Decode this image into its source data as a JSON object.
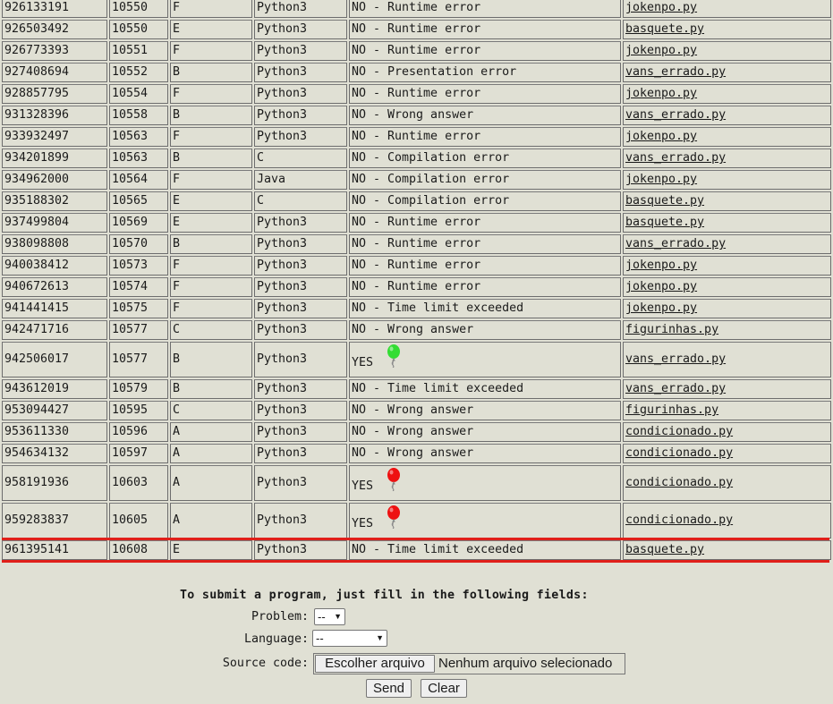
{
  "runs": [
    {
      "id": "926133191",
      "problem": "10550",
      "letter": "F",
      "lang": "Python3",
      "answer": "NO - Runtime error",
      "file": "jokenpo.py"
    },
    {
      "id": "926503492",
      "problem": "10550",
      "letter": "E",
      "lang": "Python3",
      "answer": "NO - Runtime error",
      "file": "basquete.py"
    },
    {
      "id": "926773393",
      "problem": "10551",
      "letter": "F",
      "lang": "Python3",
      "answer": "NO - Runtime error",
      "file": "jokenpo.py"
    },
    {
      "id": "927408694",
      "problem": "10552",
      "letter": "B",
      "lang": "Python3",
      "answer": "NO - Presentation error",
      "file": "vans_errado.py"
    },
    {
      "id": "928857795",
      "problem": "10554",
      "letter": "F",
      "lang": "Python3",
      "answer": "NO - Runtime error",
      "file": "jokenpo.py"
    },
    {
      "id": "931328396",
      "problem": "10558",
      "letter": "B",
      "lang": "Python3",
      "answer": "NO - Wrong answer",
      "file": "vans_errado.py"
    },
    {
      "id": "933932497",
      "problem": "10563",
      "letter": "F",
      "lang": "Python3",
      "answer": "NO - Runtime error",
      "file": "jokenpo.py"
    },
    {
      "id": "934201899",
      "problem": "10563",
      "letter": "B",
      "lang": "C",
      "answer": "NO - Compilation error",
      "file": "vans_errado.py"
    },
    {
      "id": "934962000",
      "problem": "10564",
      "letter": "F",
      "lang": "Java",
      "answer": "NO - Compilation error",
      "file": "jokenpo.py"
    },
    {
      "id": "935188302",
      "problem": "10565",
      "letter": "E",
      "lang": "C",
      "answer": "NO - Compilation error",
      "file": "basquete.py"
    },
    {
      "id": "937499804",
      "problem": "10569",
      "letter": "E",
      "lang": "Python3",
      "answer": "NO - Runtime error",
      "file": "basquete.py"
    },
    {
      "id": "938098808",
      "problem": "10570",
      "letter": "B",
      "lang": "Python3",
      "answer": "NO - Runtime error",
      "file": "vans_errado.py"
    },
    {
      "id": "940038412",
      "problem": "10573",
      "letter": "F",
      "lang": "Python3",
      "answer": "NO - Runtime error",
      "file": "jokenpo.py"
    },
    {
      "id": "940672613",
      "problem": "10574",
      "letter": "F",
      "lang": "Python3",
      "answer": "NO - Runtime error",
      "file": "jokenpo.py"
    },
    {
      "id": "941441415",
      "problem": "10575",
      "letter": "F",
      "lang": "Python3",
      "answer": "NO - Time limit exceeded",
      "file": "jokenpo.py"
    },
    {
      "id": "942471716",
      "problem": "10577",
      "letter": "C",
      "lang": "Python3",
      "answer": "NO - Wrong answer",
      "file": "figurinhas.py"
    },
    {
      "id": "942506017",
      "problem": "10577",
      "letter": "B",
      "lang": "Python3",
      "answer": "YES",
      "balloon": "#33dd33",
      "file": "vans_errado.py"
    },
    {
      "id": "943612019",
      "problem": "10579",
      "letter": "B",
      "lang": "Python3",
      "answer": "NO - Time limit exceeded",
      "file": "vans_errado.py"
    },
    {
      "id": "953094427",
      "problem": "10595",
      "letter": "C",
      "lang": "Python3",
      "answer": "NO - Wrong answer",
      "file": "figurinhas.py"
    },
    {
      "id": "953611330",
      "problem": "10596",
      "letter": "A",
      "lang": "Python3",
      "answer": "NO - Wrong answer",
      "file": "condicionado.py"
    },
    {
      "id": "954634132",
      "problem": "10597",
      "letter": "A",
      "lang": "Python3",
      "answer": "NO - Wrong answer",
      "file": "condicionado.py"
    },
    {
      "id": "958191936",
      "problem": "10603",
      "letter": "A",
      "lang": "Python3",
      "answer": "YES",
      "balloon": "#ee1111",
      "file": "condicionado.py"
    },
    {
      "id": "959283837",
      "problem": "10605",
      "letter": "A",
      "lang": "Python3",
      "answer": "YES",
      "balloon": "#ee1111",
      "file": "condicionado.py"
    },
    {
      "id": "961395141",
      "problem": "10608",
      "letter": "E",
      "lang": "Python3",
      "answer": "NO - Time limit exceeded",
      "file": "basquete.py",
      "highlighted": true
    }
  ],
  "highlight_color": "#e0201a",
  "form": {
    "title": "To submit a program, just fill in the following fields:",
    "problem_label": "Problem:",
    "problem_value": "--",
    "language_label": "Language:",
    "language_value": "--",
    "source_label": "Source code:",
    "choose_file_label": "Escolher arquivo",
    "no_file_text": "Nenhum arquivo selecionado",
    "send_label": "Send",
    "clear_label": "Clear"
  }
}
